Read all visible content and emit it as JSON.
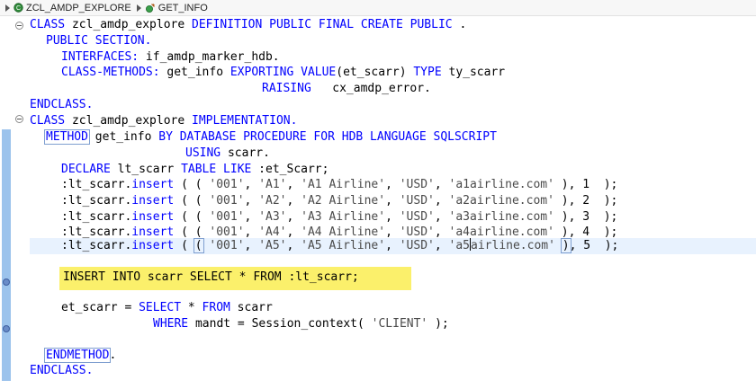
{
  "breadcrumb": {
    "class_name": "ZCL_AMDP_EXPLORE",
    "method_name": "GET_INFO"
  },
  "colors": {
    "keyword": "#0000ff",
    "highlight_line": "#e8f2fe",
    "insert_highlight": "#fbf06b",
    "change_bar": "#9cc3ec"
  },
  "code": {
    "l01": {
      "a": "CLASS",
      "b": " zcl_amdp_explore ",
      "c": "DEFINITION PUBLIC FINAL CREATE PUBLIC",
      "d": " ."
    },
    "l02": {
      "a": "PUBLIC SECTION."
    },
    "l03": {
      "a": "INTERFACES:",
      "b": " if_amdp_marker_hdb."
    },
    "l04": {
      "a": "CLASS-METHODS:",
      "b": " get_info ",
      "c": "EXPORTING VALUE",
      "d": "(et_scarr) ",
      "e": "TYPE",
      "f": " ty_scarr"
    },
    "l05": {
      "a": "RAISING",
      "b": "   cx_amdp_error."
    },
    "l06": {
      "a": "ENDCLASS."
    },
    "l07": {
      "a": "CLASS",
      "b": " zcl_amdp_explore ",
      "c": "IMPLEMENTATION."
    },
    "l08": {
      "a": "METHOD",
      "b": " get_info ",
      "c": "BY DATABASE PROCEDURE FOR HDB LANGUAGE SQLSCRIPT"
    },
    "l09": {
      "a": "USING",
      "b": " scarr."
    },
    "l10": {
      "a": "DECLARE",
      "b": " lt_scarr ",
      "c": "TABLE LIKE",
      "d": " :et_Scarr;"
    },
    "l11": {
      "a": ":lt_scarr.",
      "b": "insert",
      "c": " ( ( ",
      "d": "'001'",
      "e": ", ",
      "f": "'A1'",
      "g": ", ",
      "h": "'A1 Airline'",
      "i": ", ",
      "j": "'USD'",
      "k": ", ",
      "l": "'a1airline.com'",
      "m": " ), 1  );"
    },
    "l12": {
      "a": ":lt_scarr.",
      "b": "insert",
      "c": " ( ( ",
      "d": "'001'",
      "e": ", ",
      "f": "'A2'",
      "g": ", ",
      "h": "'A2 Airline'",
      "i": ", ",
      "j": "'USD'",
      "k": ", ",
      "l": "'a2airline.com'",
      "m": " ), 2  );"
    },
    "l13": {
      "a": ":lt_scarr.",
      "b": "insert",
      "c": " ( ( ",
      "d": "'001'",
      "e": ", ",
      "f": "'A3'",
      "g": ", ",
      "h": "'A3 Airline'",
      "i": ", ",
      "j": "'USD'",
      "k": ", ",
      "l": "'a3airline.com'",
      "m": " ), 3  );"
    },
    "l14": {
      "a": ":lt_scarr.",
      "b": "insert",
      "c": " ( ( ",
      "d": "'001'",
      "e": ", ",
      "f": "'A4'",
      "g": ", ",
      "h": "'A4 Airline'",
      "i": ", ",
      "j": "'USD'",
      "k": ", ",
      "l": "'a4airline.com'",
      "m": " ), 4  );"
    },
    "l15": {
      "a": ":lt_scarr.",
      "b": "insert",
      "c": " ( ",
      "d": "(",
      "e": " ",
      "f": "'001'",
      "g": ", ",
      "h": "'A5'",
      "i": ", ",
      "j": "'A5 Airline'",
      "k": ", ",
      "l": "'USD'",
      "m": ", ",
      "n": "'a5",
      "o": "airline.com'",
      "p": " ",
      "q": ")",
      "r": ", 5  );"
    },
    "l16": {
      "a": "INSERT INTO scarr SELECT * FROM :lt_scarr;"
    },
    "l17": {
      "a": "et_scarr = ",
      "b": "SELECT",
      "c": " * ",
      "d": "FROM",
      "e": " scarr"
    },
    "l18": {
      "a": "WHERE",
      "b": " mandt = Session_context( ",
      "c": "'CLIENT'",
      "d": " );"
    },
    "l19": {
      "a": "ENDMETHOD",
      "b": "."
    },
    "l20": {
      "a": "ENDCLASS."
    }
  }
}
